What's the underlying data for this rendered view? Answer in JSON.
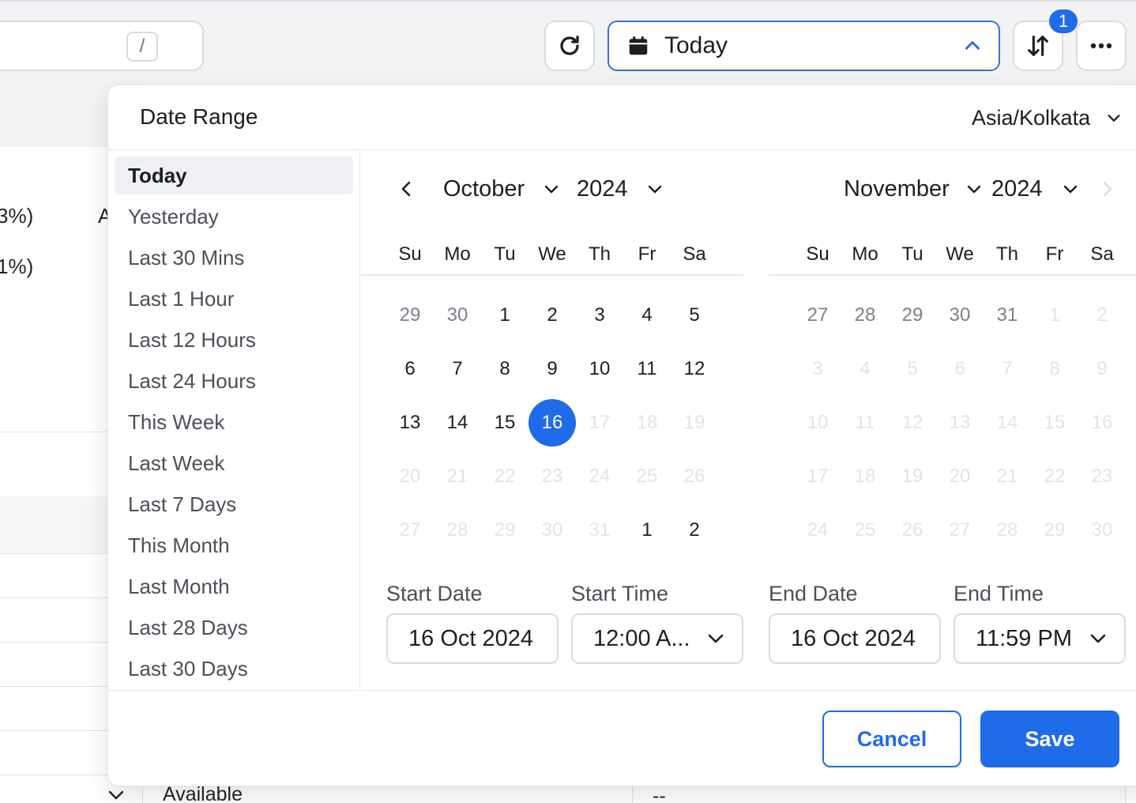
{
  "background": {
    "search": {
      "shortcut": "/"
    },
    "date_trigger": {
      "label": "Today"
    },
    "sort_badge": "1",
    "snippets": [
      "3%)",
      "1%)",
      "A",
      "Available",
      "--"
    ]
  },
  "popover": {
    "title": "Date Range",
    "timezone": "Asia/Kolkata",
    "presets": [
      "Today",
      "Yesterday",
      "Last 30 Mins",
      "Last 1 Hour",
      "Last 12 Hours",
      "Last 24 Hours",
      "This Week",
      "Last Week",
      "Last 7 Days",
      "This Month",
      "Last Month",
      "Last 28 Days",
      "Last 30 Days"
    ],
    "active_preset": "Today",
    "weekdays": [
      "Su",
      "Mo",
      "Tu",
      "We",
      "Th",
      "Fr",
      "Sa"
    ],
    "left_calendar": {
      "month": "October",
      "year": "2024",
      "weeks": [
        [
          "29",
          "30",
          "1",
          "2",
          "3",
          "4",
          "5"
        ],
        [
          "6",
          "7",
          "8",
          "9",
          "10",
          "11",
          "12"
        ],
        [
          "13",
          "14",
          "15",
          "16",
          "17",
          "18",
          "19"
        ],
        [
          "20",
          "21",
          "22",
          "23",
          "24",
          "25",
          "26"
        ],
        [
          "27",
          "28",
          "29",
          "30",
          "31",
          "1",
          "2"
        ]
      ],
      "states": [
        [
          "muted",
          "muted",
          "",
          "",
          "",
          "",
          ""
        ],
        [
          "",
          "",
          "",
          "",
          "",
          "",
          ""
        ],
        [
          "",
          "",
          "",
          "selected",
          "disabled",
          "disabled",
          "disabled"
        ],
        [
          "disabled",
          "disabled",
          "disabled",
          "disabled",
          "disabled",
          "disabled",
          "disabled"
        ],
        [
          "disabled",
          "disabled",
          "disabled",
          "disabled",
          "disabled",
          "",
          ""
        ]
      ]
    },
    "right_calendar": {
      "month": "November",
      "year": "2024",
      "weeks": [
        [
          "27",
          "28",
          "29",
          "30",
          "31",
          "1",
          "2"
        ],
        [
          "3",
          "4",
          "5",
          "6",
          "7",
          "8",
          "9"
        ],
        [
          "10",
          "11",
          "12",
          "13",
          "14",
          "15",
          "16"
        ],
        [
          "17",
          "18",
          "19",
          "20",
          "21",
          "22",
          "23"
        ],
        [
          "24",
          "25",
          "26",
          "27",
          "28",
          "29",
          "30"
        ]
      ],
      "states": [
        [
          "muted",
          "muted",
          "muted",
          "muted",
          "muted",
          "disabled",
          "disabled"
        ],
        [
          "disabled",
          "disabled",
          "disabled",
          "disabled",
          "disabled",
          "disabled",
          "disabled"
        ],
        [
          "disabled",
          "disabled",
          "disabled",
          "disabled",
          "disabled",
          "disabled",
          "disabled"
        ],
        [
          "disabled",
          "disabled",
          "disabled",
          "disabled",
          "disabled",
          "disabled",
          "disabled"
        ],
        [
          "disabled",
          "disabled",
          "disabled",
          "disabled",
          "disabled",
          "disabled",
          "disabled"
        ]
      ]
    },
    "fields": {
      "start_date_label": "Start Date",
      "start_date": "16 Oct 2024",
      "start_time_label": "Start Time",
      "start_time": "12:00 A...",
      "end_date_label": "End Date",
      "end_date": "16 Oct 2024",
      "end_time_label": "End Time",
      "end_time": "11:59 PM"
    },
    "buttons": {
      "cancel": "Cancel",
      "save": "Save"
    }
  },
  "colors": {
    "accent": "#1f6bea",
    "border": "#d8dbe0",
    "muted_day": "#7b8088",
    "disabled_day": "#e2e4e8"
  }
}
